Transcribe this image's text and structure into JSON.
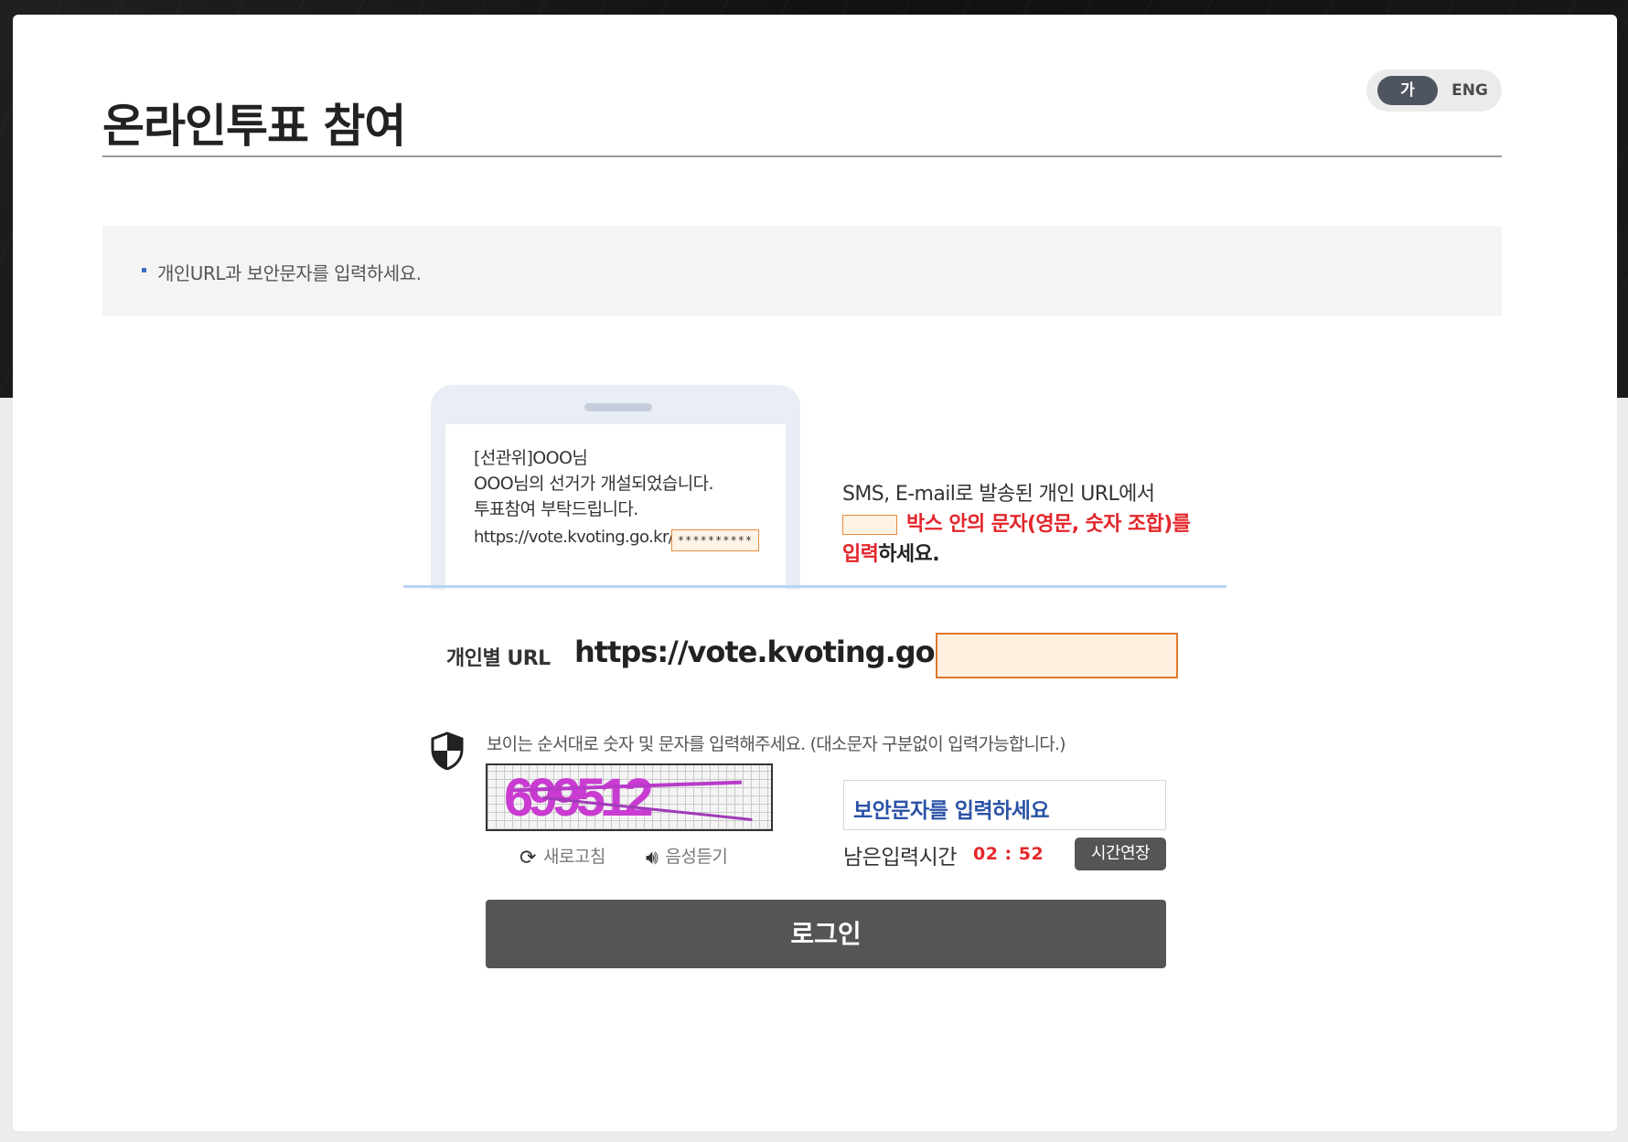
{
  "page": {
    "title": "온라인투표 참여"
  },
  "language": {
    "korean_label": "가",
    "english_label": "ENG",
    "selected": "가"
  },
  "notice": {
    "text": "개인URL과 보안문자를 입력하세요."
  },
  "sms_example": {
    "line1": "[선관위]OOO님",
    "line2": "OOO님의 선거가 개설되었습니다.",
    "line3": "투표참여 부탁드립니다.",
    "url": "https://vote.kvoting.go.kr/",
    "masked_code": "**********"
  },
  "instruction": {
    "line1": "SMS, E-mail로 발송된 개인 URL에서",
    "line2_red": "박스 안의 문자(영문, 숫자 조합)를",
    "line3_red": "입력",
    "line3_rest": "하세요."
  },
  "url_row": {
    "label": "개인별 URL",
    "prefix": "https://vote.kvoting.go.kr/",
    "input_value": ""
  },
  "captcha": {
    "hint": "보이는 순서대로 숫자 및 문자를 입력해주세요. (대소문자 구분없이 입력가능합니다.)",
    "code": "699512",
    "refresh_label": "새로고침",
    "audio_label": "음성듣기",
    "input_placeholder": "보안문자를 입력하세요"
  },
  "timer": {
    "label": "남은입력시간",
    "value": "02 : 52",
    "extend_label": "시간연장"
  },
  "login": {
    "label": "로그인"
  },
  "colors": {
    "accent_red": "#e3262b",
    "button_gray": "#555555",
    "input_orange": "#e0782c"
  }
}
